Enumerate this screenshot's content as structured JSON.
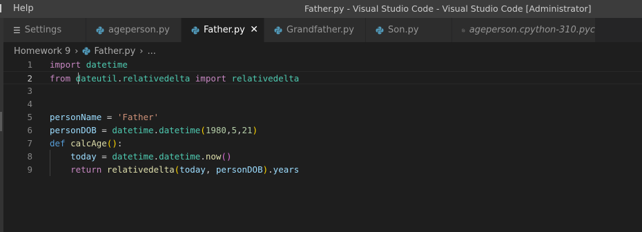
{
  "titlebar": {
    "menu_help": "Help",
    "title": "Father.py - Visual Studio Code - Visual Studio Code [Administrator]"
  },
  "tabs": [
    {
      "label": "Settings",
      "icon": "settings-icon",
      "active": false
    },
    {
      "label": "ageperson.py",
      "icon": "python-icon",
      "active": false
    },
    {
      "label": "Father.py",
      "icon": "python-icon",
      "active": true,
      "close": "✕"
    },
    {
      "label": "Grandfather.py",
      "icon": "python-icon",
      "active": false
    },
    {
      "label": "Son.py",
      "icon": "python-icon",
      "active": false
    },
    {
      "label": "ageperson.cpython-310.pyc",
      "icon": "file-icon",
      "active": false
    }
  ],
  "breadcrumb": {
    "folder": "Homework 9",
    "file": "Father.py",
    "ellipsis": "..."
  },
  "editor": {
    "line_numbers": [
      "1",
      "2",
      "3",
      "4",
      "5",
      "6",
      "7",
      "8",
      "9"
    ],
    "current_line": 2,
    "lines": [
      [
        [
          "k",
          "import"
        ],
        [
          "p",
          " "
        ],
        [
          "m",
          "datetime"
        ]
      ],
      [
        [
          "k",
          "from"
        ],
        [
          "p",
          " "
        ],
        [
          "m",
          "dateutil"
        ],
        [
          "p",
          "."
        ],
        [
          "m",
          "relativedelta"
        ],
        [
          "p",
          " "
        ],
        [
          "k",
          "import"
        ],
        [
          "p",
          " "
        ],
        [
          "m",
          "relativedelta"
        ]
      ],
      [],
      [],
      [
        [
          "v",
          "personName"
        ],
        [
          "p",
          " = "
        ],
        [
          "s",
          "'Father'"
        ]
      ],
      [
        [
          "v",
          "personDOB"
        ],
        [
          "p",
          " = "
        ],
        [
          "m",
          "datetime"
        ],
        [
          "p",
          "."
        ],
        [
          "m",
          "datetime"
        ],
        [
          "br1",
          "("
        ],
        [
          "n",
          "1980"
        ],
        [
          "p",
          ","
        ],
        [
          "n",
          "5"
        ],
        [
          "p",
          ","
        ],
        [
          "n",
          "21"
        ],
        [
          "br1",
          ")"
        ]
      ],
      [
        [
          "kd",
          "def"
        ],
        [
          "p",
          " "
        ],
        [
          "f",
          "calcAge"
        ],
        [
          "br1",
          "("
        ],
        [
          "br1",
          ")"
        ],
        [
          "p",
          ":"
        ]
      ],
      [
        [
          "p",
          "    "
        ],
        [
          "v",
          "today"
        ],
        [
          "p",
          " = "
        ],
        [
          "m",
          "datetime"
        ],
        [
          "p",
          "."
        ],
        [
          "m",
          "datetime"
        ],
        [
          "p",
          "."
        ],
        [
          "f",
          "now"
        ],
        [
          "br2",
          "("
        ],
        [
          "br2",
          ")"
        ]
      ],
      [
        [
          "p",
          "    "
        ],
        [
          "k",
          "return"
        ],
        [
          "p",
          " "
        ],
        [
          "f",
          "relativedelta"
        ],
        [
          "br1",
          "("
        ],
        [
          "v",
          "today"
        ],
        [
          "p",
          ", "
        ],
        [
          "v",
          "personDOB"
        ],
        [
          "br1",
          ")"
        ],
        [
          "p",
          "."
        ],
        [
          "v",
          "years"
        ]
      ]
    ]
  },
  "colors": {
    "editor_bg": "#1e1e1e",
    "titlebar_bg": "#3c3c3c",
    "tab_inactive_bg": "#2d2d2d",
    "python_icon": "#519aba"
  }
}
